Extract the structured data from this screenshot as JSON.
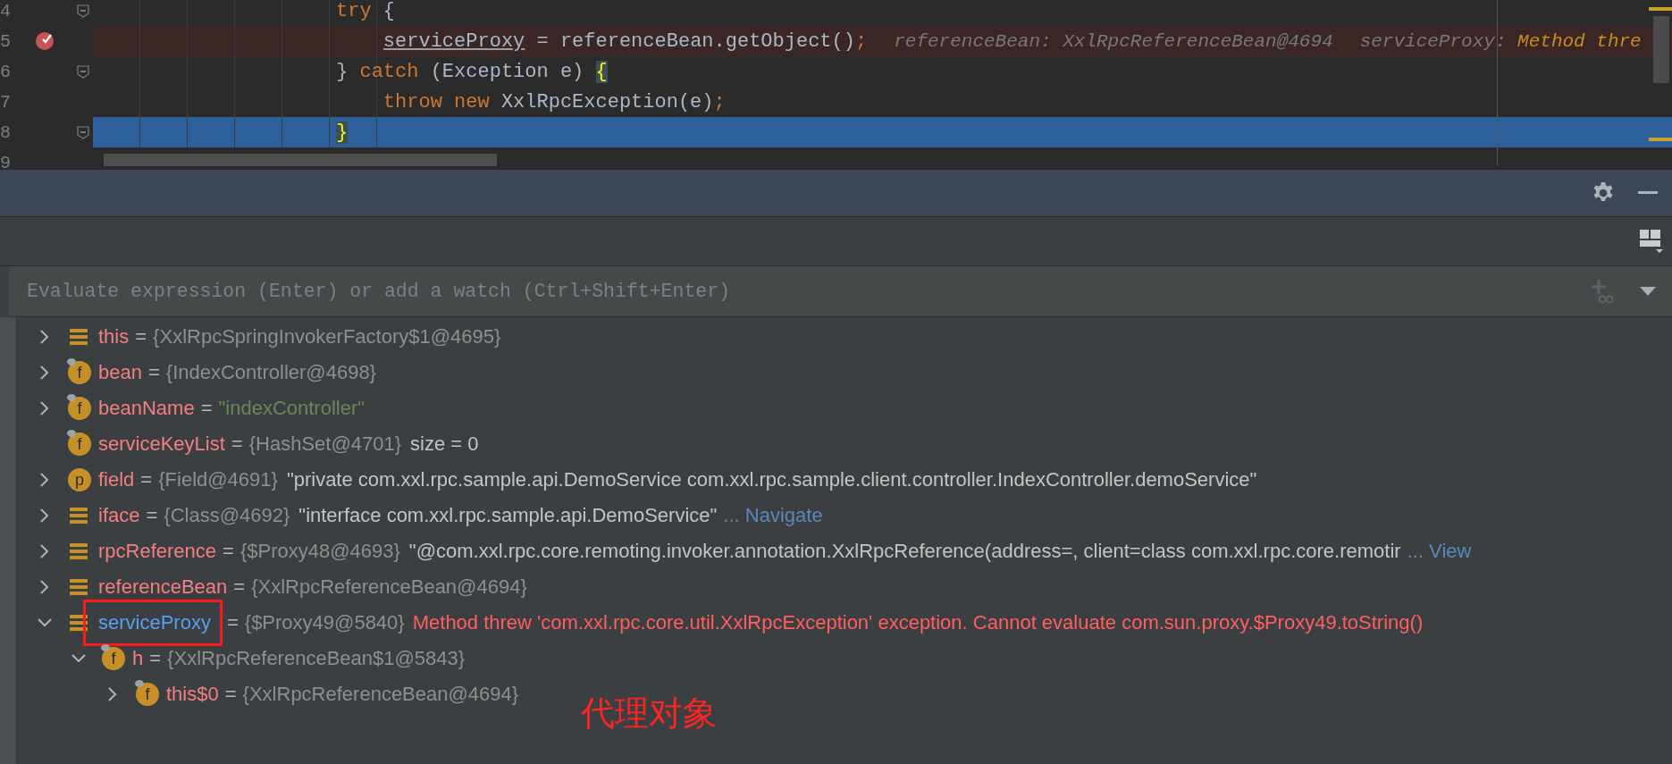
{
  "editor": {
    "lines": [
      {
        "number": "4",
        "fold": true,
        "breakpoint": false,
        "current": false,
        "tokens": [
          {
            "kind": "keyword",
            "text": "                    try"
          },
          {
            "kind": "plain",
            "text": " {"
          }
        ]
      },
      {
        "number": "5",
        "fold": false,
        "breakpoint": true,
        "current": false,
        "tokens": [
          {
            "kind": "variable",
            "text": "                        serviceProxy"
          },
          {
            "kind": "plain",
            "text": " = referenceBean.getObject()"
          },
          {
            "kind": "keyword",
            "text": ";"
          }
        ],
        "hints": [
          {
            "parts": [
              {
                "kind": "plain",
                "text": "referenceBean: XxlRpcReferenceBean@4694"
              }
            ]
          },
          {
            "parts": [
              {
                "kind": "plain",
                "text": "serviceProxy: "
              },
              {
                "kind": "error",
                "text": "Method thre"
              }
            ]
          }
        ]
      },
      {
        "number": "6",
        "fold": true,
        "breakpoint": false,
        "current": false,
        "tokens": [
          {
            "kind": "plain",
            "text": "                    }"
          },
          {
            "kind": "keyword",
            "text": " catch"
          },
          {
            "kind": "plain",
            "text": " (Exception e) "
          },
          {
            "kind": "brace",
            "text": "{"
          }
        ]
      },
      {
        "number": "7",
        "fold": false,
        "breakpoint": false,
        "current": false,
        "tokens": [
          {
            "kind": "keyword",
            "text": "                        throw new"
          },
          {
            "kind": "plain",
            "text": " XxlRpcException(e)"
          },
          {
            "kind": "keyword",
            "text": ";"
          }
        ]
      },
      {
        "number": "8",
        "fold": true,
        "breakpoint": false,
        "current": true,
        "tokens": [
          {
            "kind": "brace",
            "text": "                    }"
          }
        ]
      },
      {
        "number": "9",
        "fold": false,
        "breakpoint": false,
        "current": false
      }
    ]
  },
  "evaluate": {
    "placeholder": "Evaluate expression (Enter) or add a watch (Ctrl+Shift+Enter)"
  },
  "variables": [
    {
      "kind": "local",
      "name": "this",
      "leaf": false,
      "expanded": false,
      "changed": false,
      "boxed": false,
      "parts": [
        {
          "kind": "op",
          "text": "="
        },
        {
          "kind": "ref",
          "text": "{XxlRpcSpringInvokerFactory$1@4695}"
        }
      ]
    },
    {
      "kind": "field",
      "badge": "f",
      "name": "bean",
      "leaf": false,
      "expanded": false,
      "changed": false,
      "boxed": false,
      "parts": [
        {
          "kind": "op",
          "text": "="
        },
        {
          "kind": "ref",
          "text": "{IndexController@4698}"
        }
      ]
    },
    {
      "kind": "field",
      "badge": "f",
      "name": "beanName",
      "leaf": false,
      "expanded": false,
      "changed": false,
      "boxed": false,
      "parts": [
        {
          "kind": "op",
          "text": "="
        },
        {
          "kind": "string",
          "text": "\"indexController\""
        }
      ]
    },
    {
      "kind": "field",
      "badge": "f",
      "name": "serviceKeyList",
      "leaf": true,
      "changed": false,
      "boxed": false,
      "parts": [
        {
          "kind": "op",
          "text": "="
        },
        {
          "kind": "ref",
          "text": "{HashSet@4701}"
        },
        {
          "kind": "text",
          "text": "size = 0"
        }
      ]
    },
    {
      "kind": "property",
      "badge": "p",
      "name": "field",
      "leaf": false,
      "expanded": false,
      "changed": false,
      "boxed": false,
      "parts": [
        {
          "kind": "op",
          "text": "="
        },
        {
          "kind": "ref",
          "text": "{Field@4691}"
        },
        {
          "kind": "text",
          "text": "\"private com.xxl.rpc.sample.api.DemoService com.xxl.rpc.sample.client.controller.IndexController.demoService\""
        }
      ]
    },
    {
      "kind": "local",
      "name": "iface",
      "leaf": false,
      "expanded": false,
      "changed": false,
      "boxed": false,
      "parts": [
        {
          "kind": "op",
          "text": "="
        },
        {
          "kind": "ref",
          "text": "{Class@4692}"
        },
        {
          "kind": "text",
          "text": "\"interface com.xxl.rpc.sample.api.DemoService\""
        },
        {
          "kind": "link",
          "text": "... Navigate"
        }
      ]
    },
    {
      "kind": "local",
      "name": "rpcReference",
      "leaf": false,
      "expanded": false,
      "changed": false,
      "boxed": false,
      "parts": [
        {
          "kind": "op",
          "text": "="
        },
        {
          "kind": "ref",
          "text": "{$Proxy48@4693}"
        },
        {
          "kind": "text",
          "text": "\"@com.xxl.rpc.core.remoting.invoker.annotation.XxlRpcReference(address=, client=class com.xxl.rpc.core.remotir"
        },
        {
          "kind": "link",
          "text": "... View"
        }
      ]
    },
    {
      "kind": "local",
      "name": "referenceBean",
      "leaf": false,
      "expanded": false,
      "changed": false,
      "boxed": false,
      "parts": [
        {
          "kind": "op",
          "text": "="
        },
        {
          "kind": "ref",
          "text": "{XxlRpcReferenceBean@4694}"
        }
      ]
    },
    {
      "kind": "local",
      "name": "serviceProxy",
      "leaf": false,
      "expanded": true,
      "changed": true,
      "boxed": true,
      "parts": [
        {
          "kind": "op",
          "text": "="
        },
        {
          "kind": "ref",
          "text": "{$Proxy49@5840}"
        },
        {
          "kind": "error",
          "text": "Method threw 'com.xxl.rpc.core.util.XxlRpcException' exception. Cannot evaluate com.sun.proxy.$Proxy49.toString()"
        }
      ],
      "children": [
        {
          "kind": "field",
          "badge": "f",
          "name": "h",
          "leaf": false,
          "expanded": true,
          "changed": false,
          "boxed": false,
          "parts": [
            {
              "kind": "op",
              "text": "="
            },
            {
              "kind": "ref",
              "text": "{XxlRpcReferenceBean$1@5843}"
            }
          ],
          "children": [
            {
              "kind": "field",
              "badge": "f",
              "name": "this$0",
              "leaf": false,
              "expanded": false,
              "changed": false,
              "boxed": false,
              "parts": [
                {
                  "kind": "op",
                  "text": "="
                },
                {
                  "kind": "ref",
                  "text": "{XxlRpcReferenceBean@4694}"
                }
              ]
            }
          ]
        }
      ]
    }
  ],
  "annotation": {
    "text": "代理对象"
  }
}
